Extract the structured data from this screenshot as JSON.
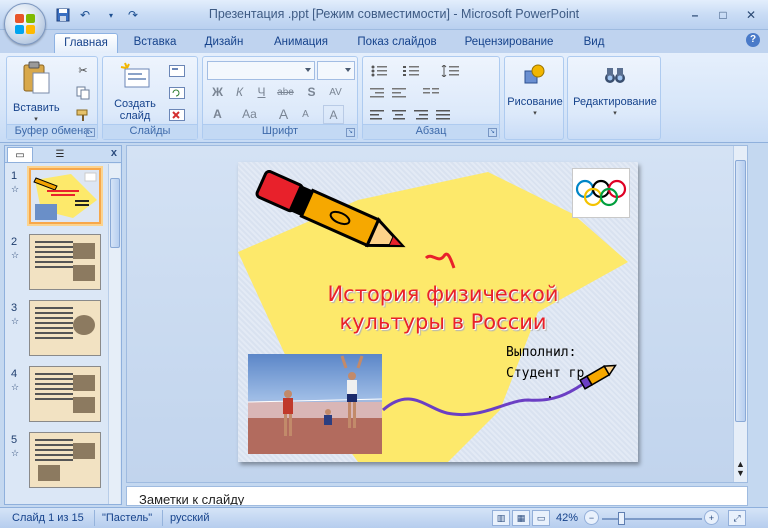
{
  "window": {
    "title": "Презентация .ppt [Режим совместимости] - Microsoft PowerPoint",
    "controls": [
      "–",
      "□",
      "✕"
    ]
  },
  "qat": {
    "save_icon": "save-icon",
    "undo": "↶",
    "redo": "↷",
    "customize": "▾"
  },
  "tabs": [
    {
      "label": "Главная",
      "active": true
    },
    {
      "label": "Вставка"
    },
    {
      "label": "Дизайн"
    },
    {
      "label": "Анимация"
    },
    {
      "label": "Показ слайдов"
    },
    {
      "label": "Рецензирование"
    },
    {
      "label": "Вид"
    }
  ],
  "help": "?",
  "ribbon": {
    "clipboard": {
      "label": "Буфер обмена",
      "paste": "Вставить"
    },
    "slides": {
      "label": "Слайды",
      "new_slide_1": "Создать",
      "new_slide_2": "слайд"
    },
    "font": {
      "label": "Шрифт",
      "bold": "Ж",
      "italic": "К",
      "underline": "Ч",
      "strike": "abe",
      "shadow": "S",
      "spacing": "AV",
      "font_color": "A",
      "case": "Aa",
      "grow": "A",
      "shrink": "A",
      "clear": "A"
    },
    "paragraph": {
      "label": "Абзац"
    },
    "drawing": {
      "label": "Рисование"
    },
    "editing": {
      "label": "Редактирование"
    }
  },
  "left_pane": {
    "slides": [
      {
        "num": "1",
        "active": true
      },
      {
        "num": "2"
      },
      {
        "num": "3"
      },
      {
        "num": "4"
      },
      {
        "num": "5"
      }
    ]
  },
  "slide": {
    "title_line1": "История физической",
    "title_line2": "культуры в России",
    "author_line1": "Выполнил:",
    "author_line2": "Студент гр",
    "author_line3": "."
  },
  "notes": {
    "placeholder": "Заметки к слайду"
  },
  "status": {
    "slide_counter": "Слайд 1 из 15",
    "theme": "\"Пастель\"",
    "language": "русский",
    "zoom": "42%"
  }
}
